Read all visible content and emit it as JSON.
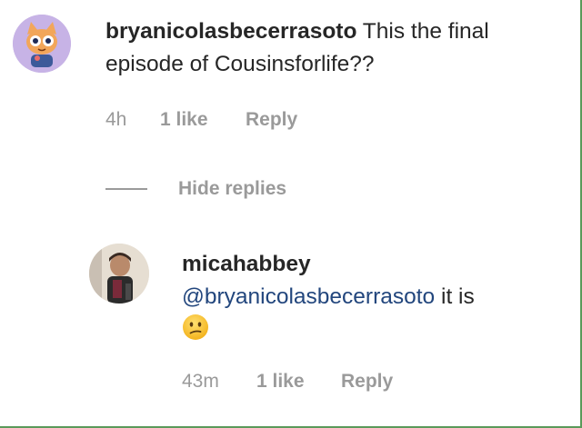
{
  "comment": {
    "username": "bryanicolasbecerrasoto",
    "text": " This the final episode of Cousinsforlife??",
    "time": "4h",
    "likes": "1 like",
    "reply_label": "Reply"
  },
  "hide_replies_label": "Hide replies",
  "reply": {
    "username": "micahabbey",
    "mention": "@bryanicolasbecerrasoto",
    "text": " it is",
    "emoji": "confused-face",
    "time": "43m",
    "likes": "1 like",
    "reply_label": "Reply"
  },
  "colors": {
    "mention": "#22467d",
    "meta": "#9a9a9a",
    "text": "#262626"
  }
}
